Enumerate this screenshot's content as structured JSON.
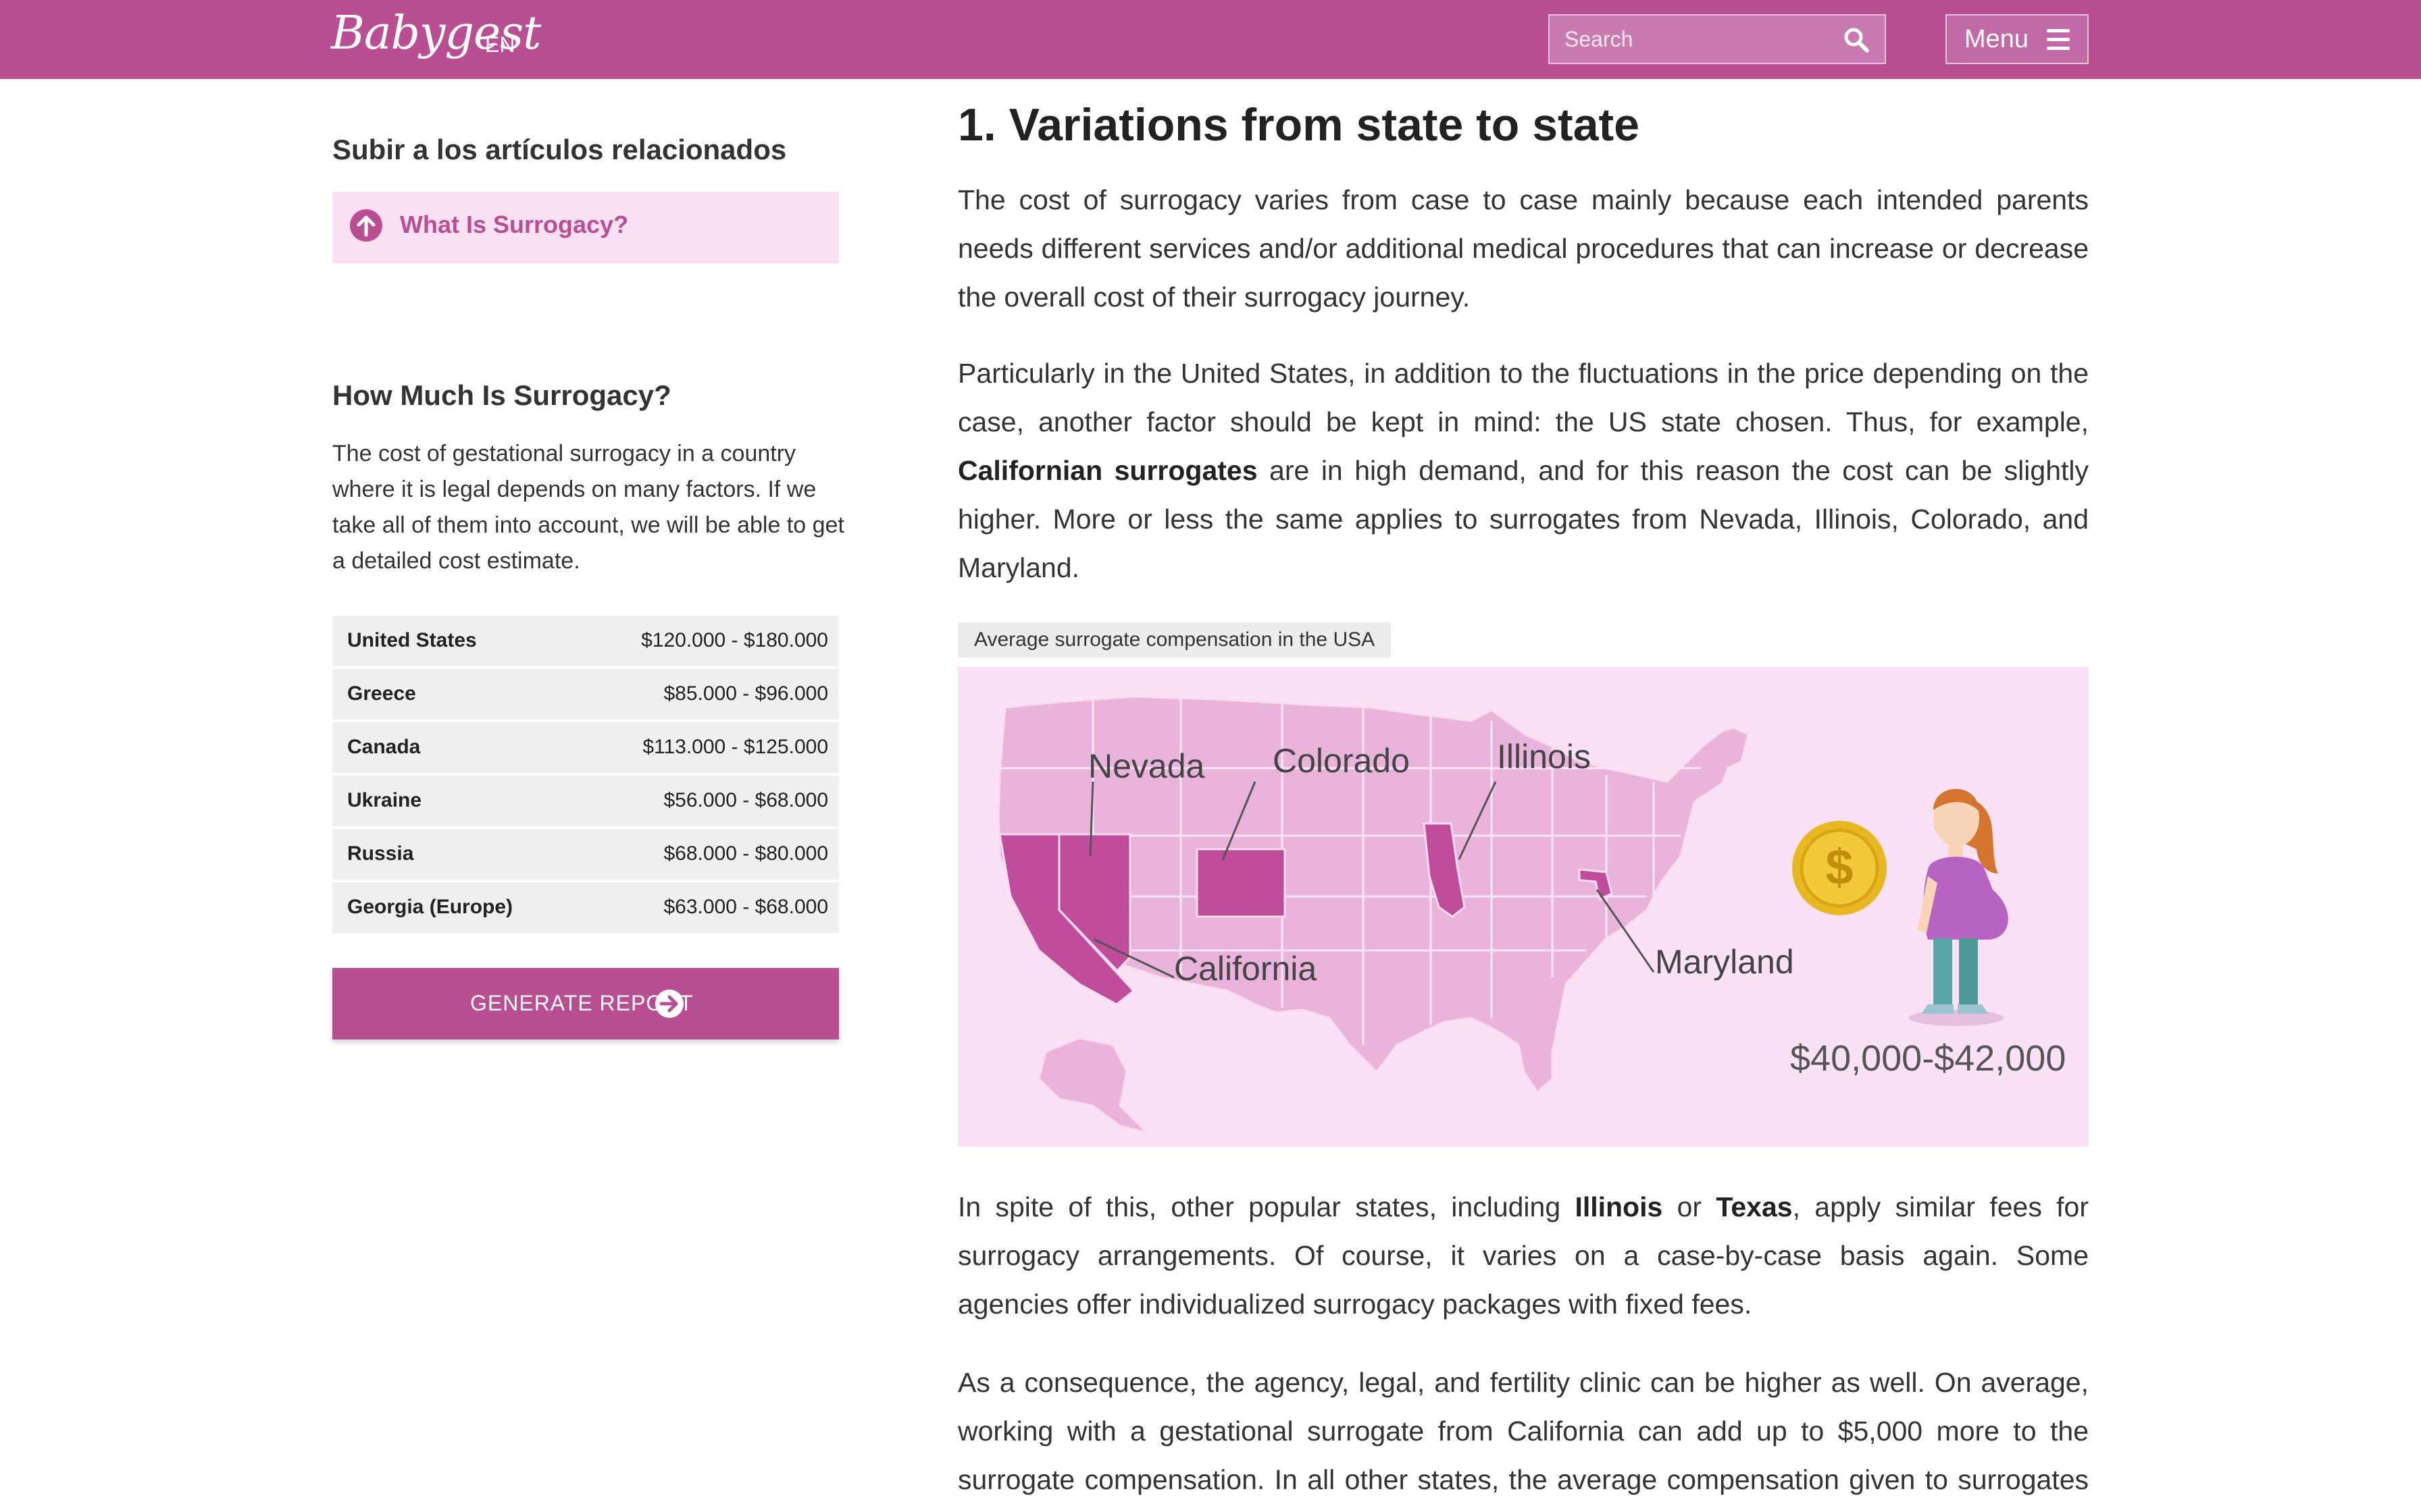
{
  "header": {
    "logo": "Babygest",
    "lang": "EN",
    "search_placeholder": "Search",
    "menu_label": "Menu"
  },
  "sidebar": {
    "related_heading": "Subir a los artículos relacionados",
    "related_link": "What Is Surrogacy?",
    "cost_heading": "How Much Is Surrogacy?",
    "cost_text": "The cost of gestational surrogacy in a country where it is legal depends on many factors. If we take all of them into account, we will be able to get a detailed cost estimate.",
    "cost_table": [
      {
        "country": "United States",
        "range": "$120.000 - $180.000"
      },
      {
        "country": "Greece",
        "range": "$85.000 - $96.000"
      },
      {
        "country": "Canada",
        "range": "$113.000 - $125.000"
      },
      {
        "country": "Ukraine",
        "range": "$56.000 - $68.000"
      },
      {
        "country": "Russia",
        "range": "$68.000 - $80.000"
      },
      {
        "country": "Georgia (Europe)",
        "range": "$63.000 - $68.000"
      }
    ],
    "report_button": "GENERATE REPORT"
  },
  "main": {
    "heading": "1. Variations from state to state",
    "p1": "The cost of surrogacy varies from case to case mainly because each intended parents needs different services and/or additional medical procedures that can increase or decrease the overall cost of their surrogacy journey.",
    "p2": {
      "a": "Particularly in the United States, in addition to the fluctuations in the price depending on the case, another factor should be kept in mind: the US state chosen. Thus, for example, ",
      "b": "Californian surrogates",
      "c": " are in high demand, and for this reason the cost can be slightly higher. More or less the same applies to surrogates from Nevada, Illinois, Colorado, and Maryland."
    },
    "figure_caption": "Average surrogate compensation in the USA",
    "figure": {
      "labels": [
        "Nevada",
        "Colorado",
        "Illinois",
        "California",
        "Maryland"
      ],
      "amount": "$40,000-$42,000",
      "colors": {
        "background": "#fae1f5",
        "states": "#eab3db",
        "highlight": "#c04c9c"
      }
    },
    "p3": {
      "a": "In spite of this, other popular states, including ",
      "b": "Illinois",
      "c": " or ",
      "d": "Texas",
      "e": ", apply similar fees for surrogacy arrangements. Of course, it varies on a case-by-case basis again. Some agencies offer individualized surrogacy packages with fixed fees."
    },
    "p4": "As a consequence, the agency, legal, and fertility clinic can be higher as well. On average, working with a gestational surrogate from California can add up to $5,000 more to the surrogate compensation. In all other states, the average compensation given to surrogates is"
  },
  "colors": {
    "brand": "#b94e93",
    "related_bg": "#f9e0f3",
    "table_bg": "#efefef"
  }
}
